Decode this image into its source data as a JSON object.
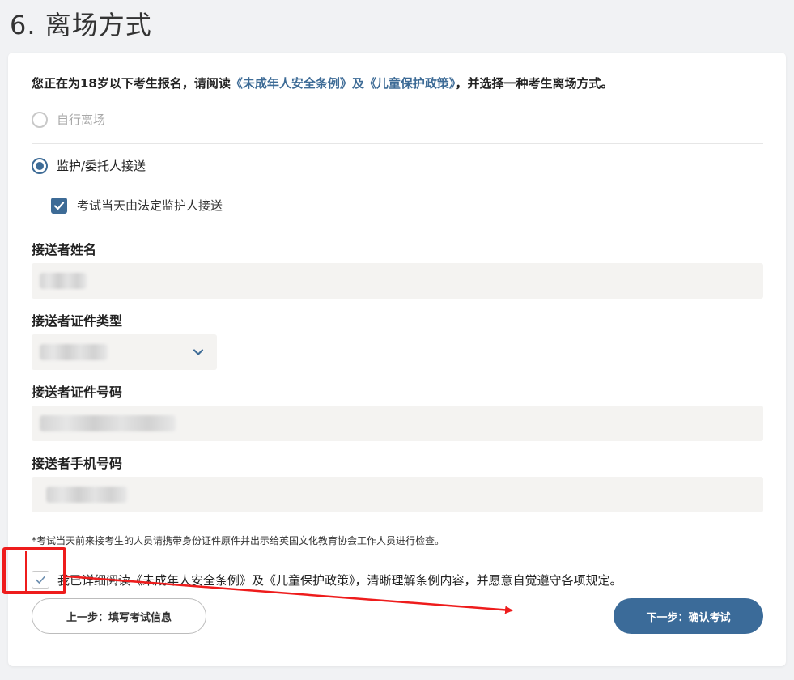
{
  "page": {
    "title": "6. 离场方式"
  },
  "intro": {
    "prefix": "您正在为18岁以下考生报名，请阅读",
    "link1": "《未成年人安全条例》",
    "conj": "及",
    "link2": "《儿童保护政策》",
    "suffix": "，并选择一种考生离场方式。"
  },
  "departure_options": [
    {
      "label": "自行离场",
      "selected": false,
      "disabled": true
    },
    {
      "label": "监护/委托人接送",
      "selected": true,
      "disabled": false
    }
  ],
  "guardian_checkbox": {
    "label": "考试当天由法定监护人接送",
    "checked": true
  },
  "fields": {
    "name_label": "接送者姓名",
    "id_type_label": "接送者证件类型",
    "id_number_label": "接送者证件号码",
    "phone_label": "接送者手机号码"
  },
  "notice": "*考试当天前来接考生的人员请携带身份证件原件并出示给英国文化教育协会工作人员进行检查。",
  "agreement": {
    "label": "我已详细阅读《未成年人安全条例》及《儿童保护政策》，清晰理解条例内容，并愿意自觉遵守各项规定。",
    "checked": true
  },
  "buttons": {
    "prev": "上一步：填写考试信息",
    "next": "下一步：确认考试"
  },
  "colors": {
    "accent": "#3d6b96",
    "annotation": "#ee1c1c",
    "input_bg": "#f4f3f1"
  }
}
